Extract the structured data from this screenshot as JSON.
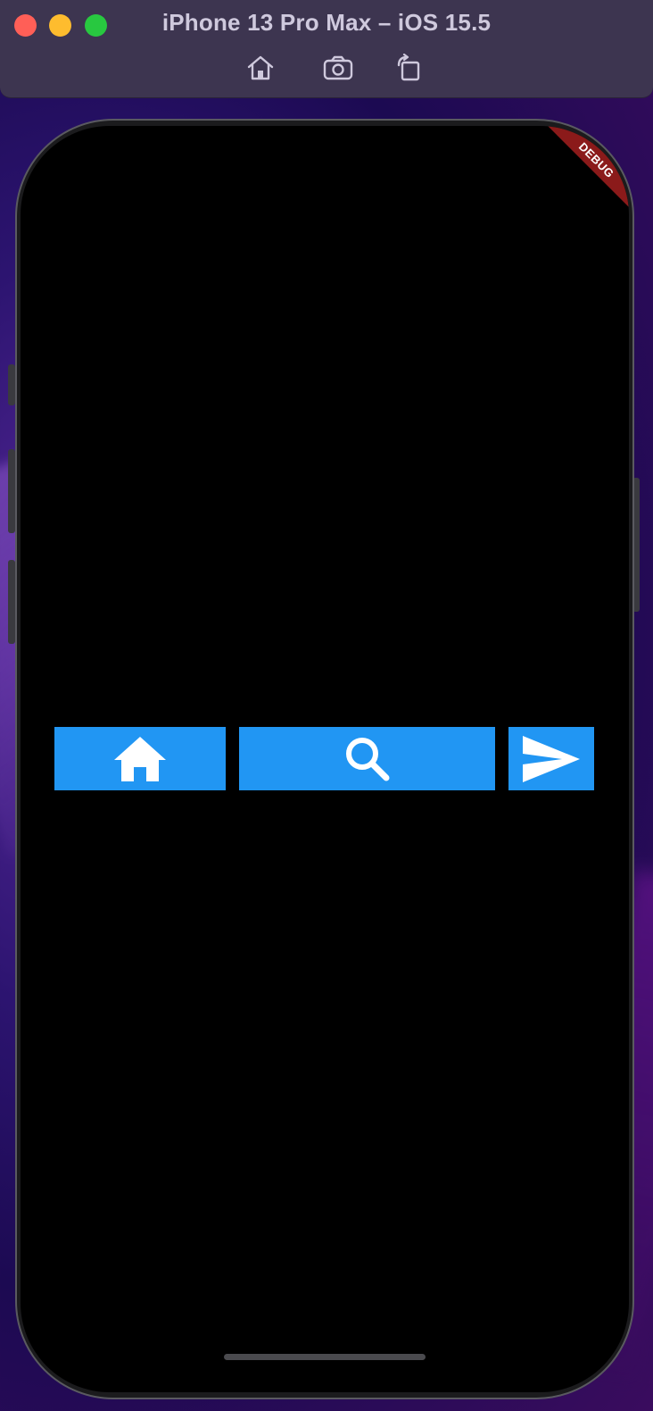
{
  "window": {
    "title": "iPhone 13 Pro Max – iOS 15.5",
    "toolbar": {
      "home_icon": "home-icon",
      "screenshot_icon": "camera-icon",
      "rotate_icon": "rotate-icon"
    }
  },
  "app": {
    "debug_banner": "DEBUG",
    "buttons": [
      {
        "icon": "home-icon"
      },
      {
        "icon": "search-icon"
      },
      {
        "icon": "send-icon"
      }
    ],
    "colors": {
      "button": "#2196f3",
      "background": "#000000",
      "banner": "#8b1a1a"
    }
  }
}
